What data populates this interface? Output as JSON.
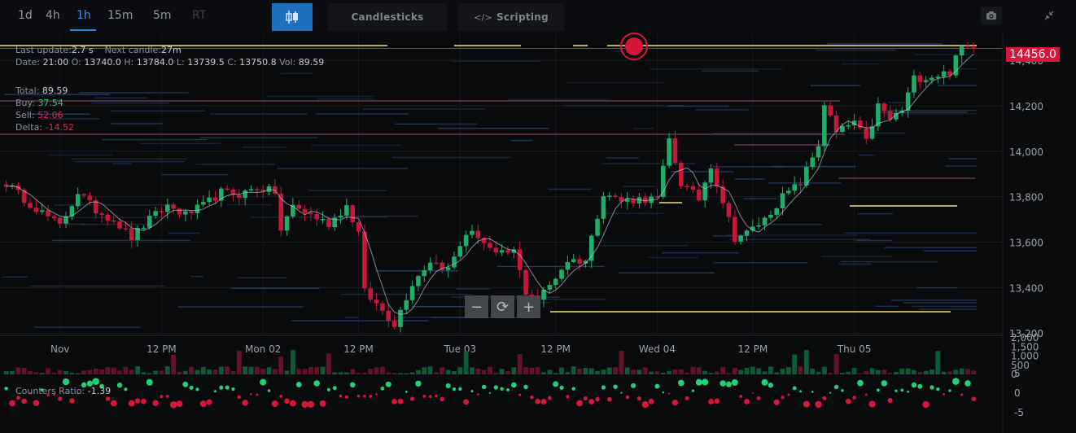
{
  "timeframes": [
    {
      "label": "1d",
      "active": false,
      "disabled": false
    },
    {
      "label": "4h",
      "active": false,
      "disabled": false
    },
    {
      "label": "1h",
      "active": true,
      "disabled": false
    },
    {
      "label": "15m",
      "active": false,
      "disabled": false
    },
    {
      "label": "5m",
      "active": false,
      "disabled": false
    },
    {
      "label": "RT",
      "active": false,
      "disabled": true
    }
  ],
  "toolbar": {
    "chart_type_icon": "candlestick-icon",
    "candlesticks_label": "Candlesticks",
    "scripting_glyph": "</>",
    "scripting_label": "Scripting",
    "camera_icon": "camera-icon",
    "collapse_icon": "collapse-icon"
  },
  "info": {
    "last_update_label": "Last update:",
    "last_update_value": "2.7 s",
    "next_candle_label": "Next candle:",
    "next_candle_value": "27m",
    "date_label": "Date:",
    "date_value": "21:00",
    "o_label": "O:",
    "o_value": "13740.0",
    "h_label": "H:",
    "h_value": "13784.0",
    "l_label": "L:",
    "l_value": "13739.5",
    "c_label": "C:",
    "c_value": "13750.8",
    "vol_label": "Vol:",
    "vol_value": "89.59",
    "total_label": "Total:",
    "total_value": "89.59",
    "buy_label": "Buy:",
    "buy_value": "37.54",
    "sell_label": "Sell:",
    "sell_value": "52.06",
    "delta_label": "Delta:",
    "delta_value": "-14.52",
    "counters_label": "Counters Ratio:",
    "counters_value": "-1.39"
  },
  "current_price": "14456.0",
  "zoom": {
    "minus": "−",
    "reset": "⟳",
    "plus": "+"
  },
  "colors": {
    "up": "#1fae6a",
    "down": "#c8183a",
    "price_line": "#d8163a",
    "sma": "#b8bcc4",
    "level_yellow": "#d8c86a",
    "level_blue": "#2a4a78"
  },
  "chart_data": {
    "type": "candlestick",
    "y_ticks": [
      "14,400",
      "14,200",
      "14,000",
      "13,800",
      "13,600",
      "13,400",
      "13,200"
    ],
    "y_tick_values": [
      14400,
      14200,
      14000,
      13800,
      13600,
      13400,
      13200
    ],
    "ylim": [
      13190,
      14515
    ],
    "x_labels": [
      "Nov",
      "12 PM",
      "Mon 02",
      "12 PM",
      "Tue 03",
      "12 PM",
      "Wed 04",
      "12 PM",
      "Thu 05"
    ],
    "x_label_bars": [
      9,
      26,
      43,
      59,
      76,
      92,
      109,
      125,
      142
    ],
    "bar_count": 163,
    "ohlc_keyframes": [
      [
        0,
        13860
      ],
      [
        3,
        13790
      ],
      [
        6,
        13730
      ],
      [
        9,
        13670
      ],
      [
        12,
        13820
      ],
      [
        15,
        13740
      ],
      [
        18,
        13700
      ],
      [
        21,
        13620
      ],
      [
        24,
        13700
      ],
      [
        27,
        13760
      ],
      [
        30,
        13720
      ],
      [
        33,
        13760
      ],
      [
        36,
        13820
      ],
      [
        39,
        13810
      ],
      [
        42,
        13840
      ],
      [
        45,
        13820
      ],
      [
        46,
        13650
      ],
      [
        48,
        13760
      ],
      [
        51,
        13720
      ],
      [
        54,
        13680
      ],
      [
        57,
        13760
      ],
      [
        59,
        13640
      ],
      [
        60,
        13380
      ],
      [
        63,
        13300
      ],
      [
        65,
        13240
      ],
      [
        68,
        13420
      ],
      [
        71,
        13520
      ],
      [
        74,
        13480
      ],
      [
        77,
        13640
      ],
      [
        79,
        13630
      ],
      [
        82,
        13540
      ],
      [
        85,
        13560
      ],
      [
        87,
        13380
      ],
      [
        89,
        13350
      ],
      [
        91,
        13410
      ],
      [
        94,
        13520
      ],
      [
        97,
        13520
      ],
      [
        100,
        13820
      ],
      [
        103,
        13780
      ],
      [
        106,
        13790
      ],
      [
        109,
        13790
      ],
      [
        111,
        14050
      ],
      [
        113,
        13860
      ],
      [
        116,
        13790
      ],
      [
        118,
        13940
      ],
      [
        120,
        13780
      ],
      [
        122,
        13620
      ],
      [
        124,
        13640
      ],
      [
        127,
        13700
      ],
      [
        130,
        13800
      ],
      [
        133,
        13860
      ],
      [
        136,
        14030
      ],
      [
        137,
        14210
      ],
      [
        139,
        14080
      ],
      [
        142,
        14130
      ],
      [
        144,
        14040
      ],
      [
        146,
        14200
      ],
      [
        148,
        14140
      ],
      [
        150,
        14180
      ],
      [
        152,
        14320
      ],
      [
        155,
        14330
      ],
      [
        158,
        14350
      ],
      [
        160,
        14460
      ],
      [
        161,
        14456
      ]
    ],
    "volume_ticks": [
      "2,000",
      "1,500",
      "1,000",
      "500",
      "0"
    ],
    "volume_tick_values": [
      2000,
      1500,
      1000,
      500,
      0
    ],
    "volume_scale_max": 2000,
    "counter_ticks": [
      "5",
      "0",
      "-5"
    ],
    "counter_tick_values": [
      5,
      0,
      -5
    ],
    "counter_scale_max": 8
  }
}
